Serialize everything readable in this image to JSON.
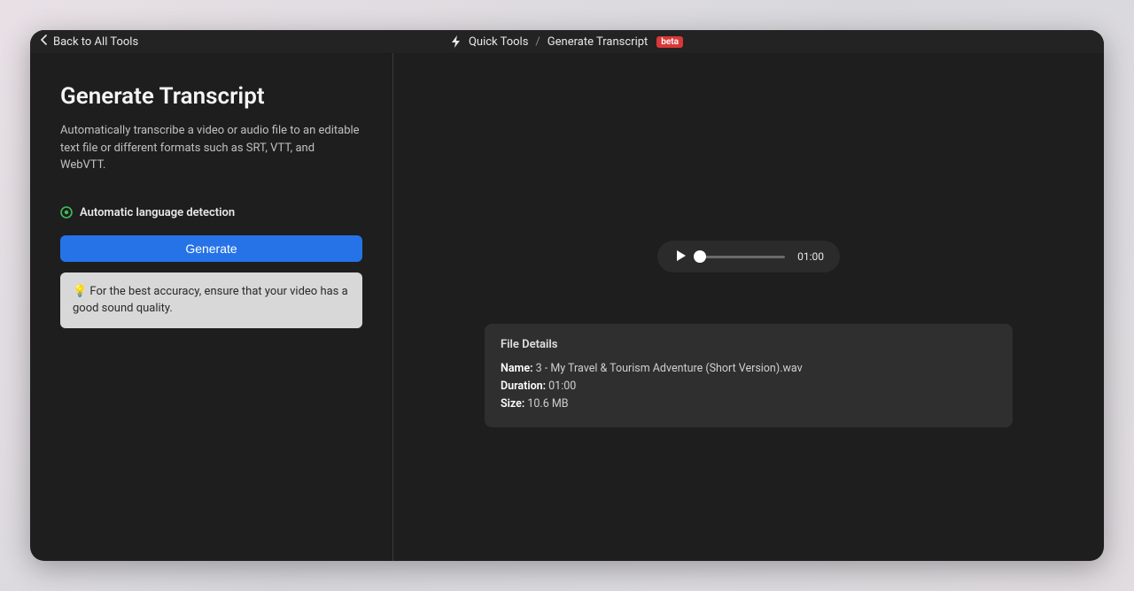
{
  "header": {
    "back_label": "Back to All Tools",
    "crumb1": "Quick Tools",
    "separator": "/",
    "crumb2": "Generate Transcript",
    "beta": "beta"
  },
  "left": {
    "title": "Generate Transcript",
    "description": "Automatically transcribe a video or audio file to an editable text file or different formats such as SRT, VTT, and WebVTT.",
    "lang_detect": "Automatic language detection",
    "generate_label": "Generate",
    "tip": "💡 For the best accuracy, ensure that your video has a good sound quality."
  },
  "player": {
    "duration": "01:00"
  },
  "file_details": {
    "heading": "File Details",
    "name_label": "Name:",
    "name_value": "3 - My Travel & Tourism Adventure (Short Version).wav",
    "duration_label": "Duration:",
    "duration_value": "01:00",
    "size_label": "Size:",
    "size_value": "10.6 MB"
  }
}
